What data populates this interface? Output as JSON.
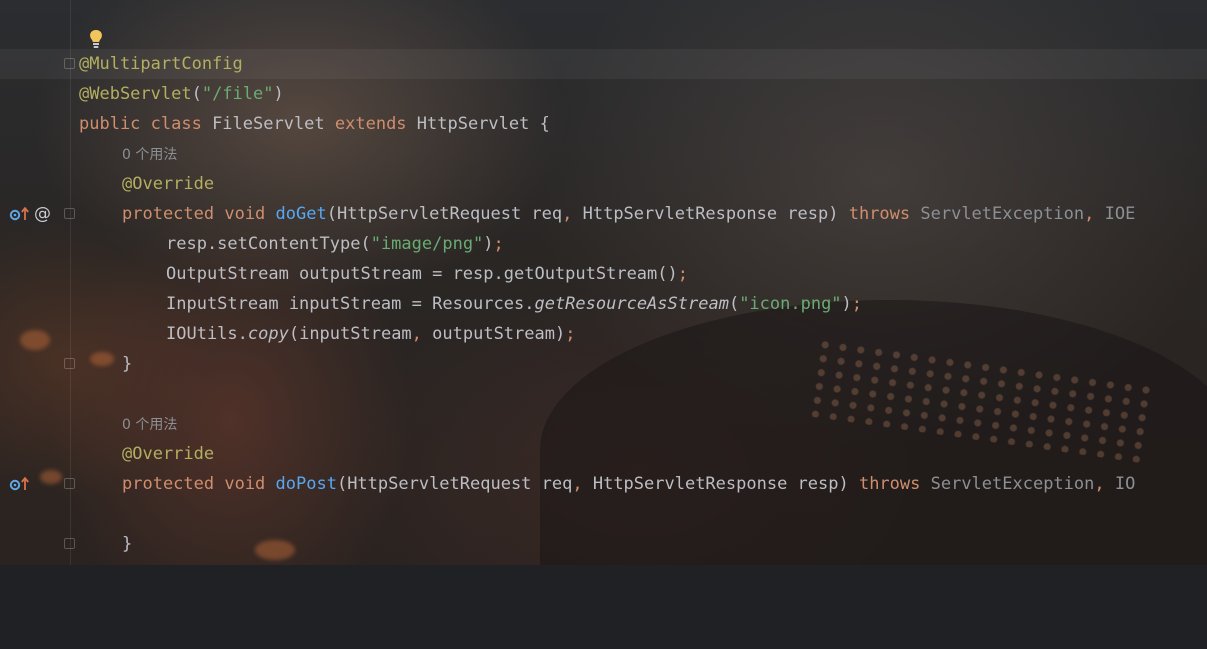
{
  "editor": {
    "hint_icon": "lightbulb-icon",
    "gutter_icons": {
      "implements": "implements-method-icon",
      "annotation": "at-annotation-icon",
      "fold": "fold-marker-icon"
    },
    "colors": {
      "keyword": "#cf8e6d",
      "annotation": "#b3ae60",
      "string": "#6aab73",
      "method_declaration": "#56a8f5",
      "text": "#bcbec4",
      "dimmed": "#8c8f94"
    },
    "lines": {
      "l1": {
        "t0": "@MultipartConfig"
      },
      "l2": {
        "t0": "@WebServlet",
        "t1": "(",
        "t2": "\"/file\"",
        "t3": ")"
      },
      "l3": {
        "t0": "public class ",
        "t1": "FileServlet ",
        "t2": "extends ",
        "t3": "HttpServlet {"
      },
      "l4": {
        "hint": "0 个用法"
      },
      "l5": {
        "t0": "@Override"
      },
      "l6": {
        "t0": "protected void ",
        "t1": "doGet",
        "t2": "(HttpServletRequest req",
        "t3": ", ",
        "t4": "HttpServletResponse resp) ",
        "t5": "throws ",
        "t6": "ServletException",
        "t7": ", ",
        "t8": "IOE"
      },
      "l7": {
        "t0": "resp.setContentType(",
        "t1": "\"image/png\"",
        "t2": ")",
        "t3": ";"
      },
      "l8": {
        "t0": "OutputStream outputStream = resp.getOutputStream()",
        "t1": ";"
      },
      "l9": {
        "t0": "InputStream inputStream = Resources.",
        "t1": "getResourceAsStream",
        "t2": "(",
        "t3": "\"icon.png\"",
        "t4": ")",
        "t5": ";"
      },
      "l10": {
        "t0": "IOUtils.",
        "t1": "copy",
        "t2": "(inputStream",
        "t3": ", ",
        "t4": "outputStream)",
        "t5": ";"
      },
      "l11": {
        "t0": "}"
      },
      "l12": {
        "hint": "0 个用法"
      },
      "l13": {
        "t0": "@Override"
      },
      "l14": {
        "t0": "protected void ",
        "t1": "doPost",
        "t2": "(HttpServletRequest req",
        "t3": ", ",
        "t4": "HttpServletResponse resp) ",
        "t5": "throws ",
        "t6": "ServletException",
        "t7": ", ",
        "t8": "IO"
      },
      "l15": {
        "t0": "}"
      }
    }
  }
}
